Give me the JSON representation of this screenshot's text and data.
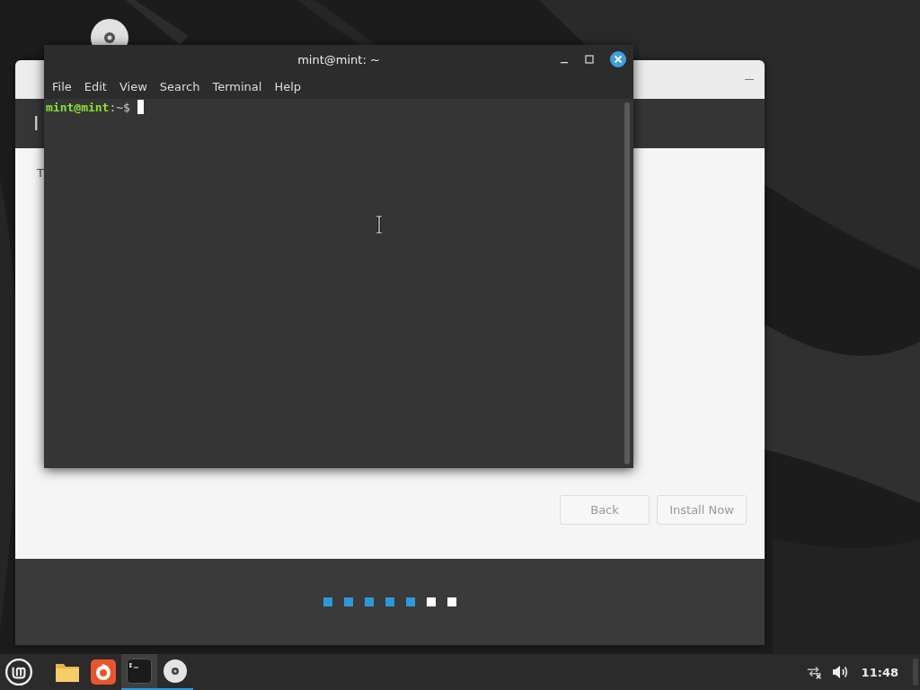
{
  "installer": {
    "heading": "I",
    "body": "T",
    "buttons": [
      {
        "label": "Back",
        "disabled": true
      },
      {
        "label": "Install Now",
        "disabled": true
      }
    ],
    "steps": [
      {
        "done": true
      },
      {
        "done": true
      },
      {
        "done": true
      },
      {
        "done": true
      },
      {
        "done": true
      },
      {
        "done": false
      },
      {
        "done": false
      }
    ]
  },
  "terminal": {
    "title": "mint@mint: ~",
    "menu": [
      "File",
      "Edit",
      "View",
      "Search",
      "Terminal",
      "Help"
    ],
    "prompt_user": "mint@mint",
    "prompt_path": ":~$"
  },
  "taskbar": {
    "apps": [
      {
        "kind": "files",
        "active": false,
        "running": false
      },
      {
        "kind": "browser",
        "active": false,
        "running": false
      },
      {
        "kind": "terminal",
        "active": true,
        "running": true
      },
      {
        "kind": "disc",
        "active": false,
        "running": true
      }
    ],
    "clock": "11:48"
  }
}
